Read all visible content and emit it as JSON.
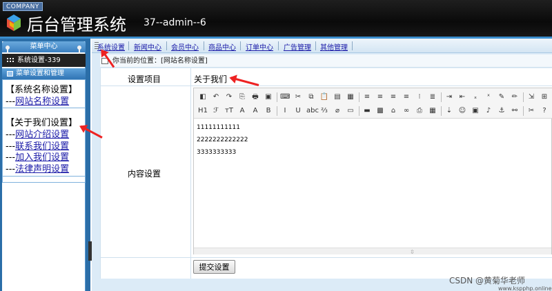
{
  "header": {
    "company_label": "COMPANY",
    "app_title": "后台管理系统",
    "user_info": "37--admin--6"
  },
  "sidebar": {
    "menu_center": "菜单中心",
    "system_user": "系统设置-339",
    "panel_title": "菜单设置和管理",
    "groups": [
      {
        "title": "【系统名称设置】",
        "items": [
          {
            "label": "网站名称设置"
          }
        ]
      },
      {
        "title": "【关于我们设置】",
        "items": [
          {
            "label": "网站介绍设置"
          },
          {
            "label": "联系我们设置"
          },
          {
            "label": "加入我们设置"
          },
          {
            "label": "法律声明设置"
          }
        ]
      }
    ],
    "item_prefix": "---"
  },
  "nav": {
    "items": [
      "系统设置",
      "新闻中心",
      "会员中心",
      "商品中心",
      "订单中心",
      "广告管理",
      "其他管理"
    ]
  },
  "breadcrumb": {
    "label": "你当前的位置：[网站名称设置]"
  },
  "form": {
    "setting_item_label": "设置项目",
    "setting_item_value": "关于我们",
    "content_label": "内容设置",
    "submit_label": "提交设置"
  },
  "editor": {
    "toolbar_row1": [
      "◧",
      "↶",
      "↷",
      "⎘",
      "🖶",
      "▣",
      "⌨",
      "✂",
      "⧉",
      "📋",
      "▤",
      "▦",
      "≡",
      "≡",
      "≡",
      "≡",
      "⁝",
      "≣",
      "⇥",
      "⇤",
      "ₓ",
      "ˣ",
      "✎",
      "✏",
      "⇲",
      "⊞"
    ],
    "toolbar_row2": [
      "H1",
      "ℱ",
      "тT",
      "A",
      "A",
      "B",
      "I",
      "U",
      "abc",
      "⅔",
      "⌀",
      "▭",
      "▬",
      "▩",
      "⌂",
      "∞",
      "⎙",
      "▦",
      "⇣",
      "☺",
      "▣",
      "♪",
      "⚓",
      "⚯",
      "✂",
      "?"
    ],
    "lines": [
      "11111111111",
      "2222222222222",
      "3333333333"
    ]
  },
  "watermark": {
    "text": "CSDN @黄菊华老师",
    "url": "www.kspphp.online"
  },
  "colors": {
    "header_bg": "#111111",
    "accent_blue": "#2b6ea8",
    "link": "#1a1aa8",
    "arrow_red": "#e22222"
  }
}
